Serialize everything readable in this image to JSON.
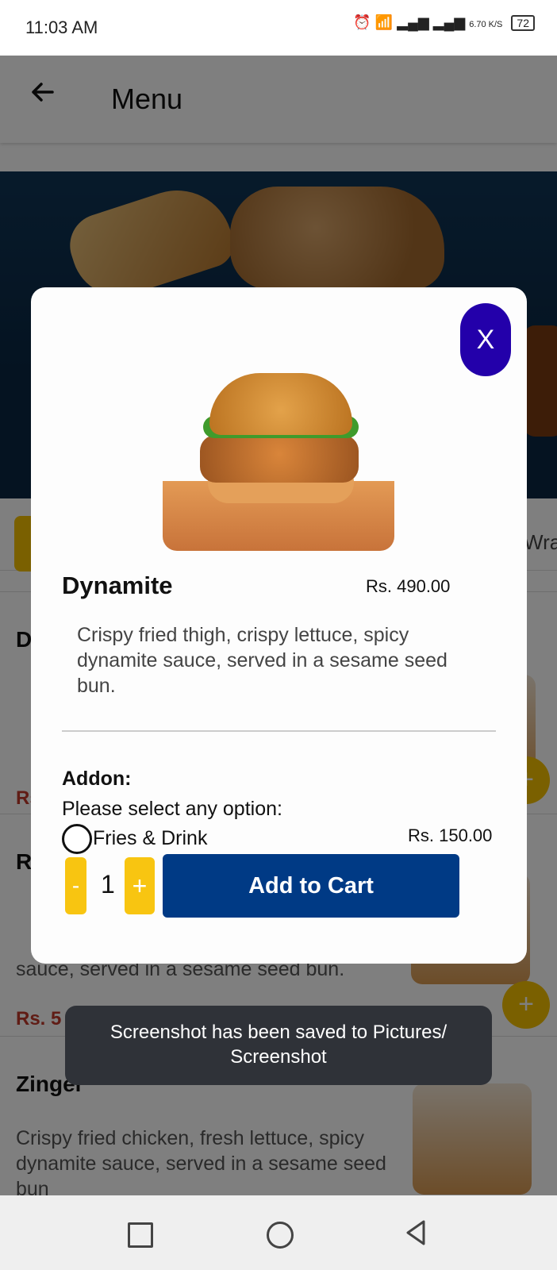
{
  "status_bar": {
    "time": "11:03 AM",
    "icons": [
      "whatsapp-icon",
      "instagram-icon",
      "alarm-icon",
      "wifi-icon",
      "volte-signal-icon",
      "volte-signal-icon"
    ],
    "network_speed": "6.70 K/S",
    "battery": "72"
  },
  "app_bar": {
    "title": "Menu",
    "back_icon": "arrow-left-icon"
  },
  "background": {
    "category_tab_right": "Wra",
    "items": [
      {
        "name": "D",
        "desc_lines": [
          "C",
          "dy",
          "se"
        ],
        "price": "Rs"
      },
      {
        "name": "R",
        "desc": "C\nto\nsauce, served in a sesame seed bun.",
        "price": "Rs. 5"
      },
      {
        "name": "Zinger",
        "desc": "Crispy fried chicken, fresh lettuce, spicy dynamite sauce, served in a sesame seed bun",
        "price": ""
      }
    ],
    "add_icon": "plus-icon"
  },
  "modal": {
    "close_label": "X",
    "product": {
      "name": "Dynamite",
      "price": "Rs. 490.00",
      "description": "Crispy fried thigh, crispy lettuce, spicy dynamite sauce, served in a sesame seed bun.",
      "image_icon": "burger-image"
    },
    "addon": {
      "title": "Addon:",
      "prompt": "Please select any option:",
      "options": [
        {
          "label": "Fries & Drink",
          "price": "Rs. 150.00",
          "selected": false
        }
      ]
    },
    "quantity": {
      "minus_label": "-",
      "value": "1",
      "plus_label": "+"
    },
    "add_to_cart_label": "Add to Cart"
  },
  "toast": {
    "message": "Screenshot has been saved to  Pictures/ Screenshot"
  },
  "nav_bar": {
    "icons": [
      "recent-apps-icon",
      "home-icon",
      "back-icon"
    ]
  },
  "colors": {
    "accent_yellow": "#f8c511",
    "primary_blue": "#003a85",
    "close_purple": "#2300aa",
    "price_red": "#c0392b"
  }
}
